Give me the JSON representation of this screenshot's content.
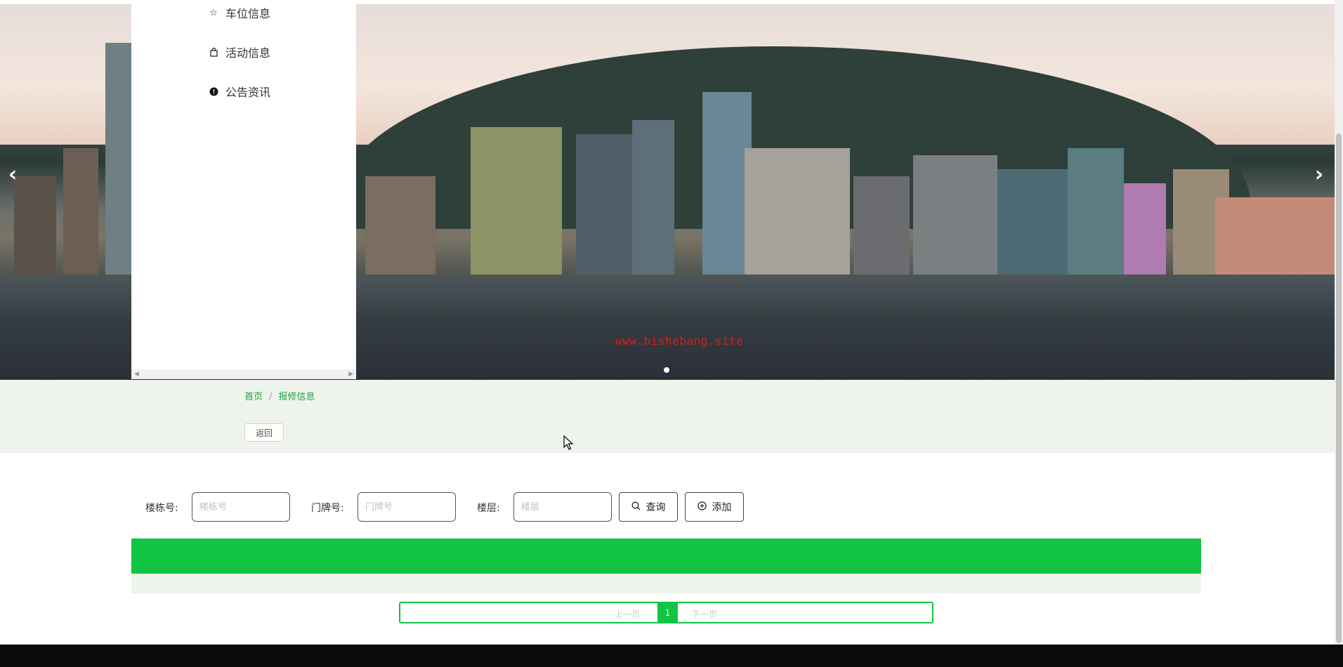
{
  "menu": {
    "items": [
      {
        "label": "车位信息",
        "icon": "star-icon"
      },
      {
        "label": "活动信息",
        "icon": "bag-icon"
      },
      {
        "label": "公告资讯",
        "icon": "exclamation-circle-icon"
      }
    ]
  },
  "banner": {
    "watermark": "www.bishebang.site",
    "prev_icon": "chevron-left-icon",
    "next_icon": "chevron-right-icon"
  },
  "breadcrumb": {
    "home": "首页",
    "separator": "/",
    "current": "报修信息"
  },
  "back_button": "返回",
  "search": {
    "building_label": "楼栋号:",
    "building_placeholder": "楼栋号",
    "door_label": "门牌号:",
    "door_placeholder": "门牌号",
    "floor_label": "楼层:",
    "floor_placeholder": "楼层",
    "query_label": "查询",
    "add_label": "添加"
  },
  "pager": {
    "prev": "上一页",
    "current_page": "1",
    "next": "下一页"
  },
  "colors": {
    "accent": "#11c443",
    "breadcrumb": "#1ea340",
    "strip": "#eef4ec",
    "watermark": "#e21a1a"
  }
}
